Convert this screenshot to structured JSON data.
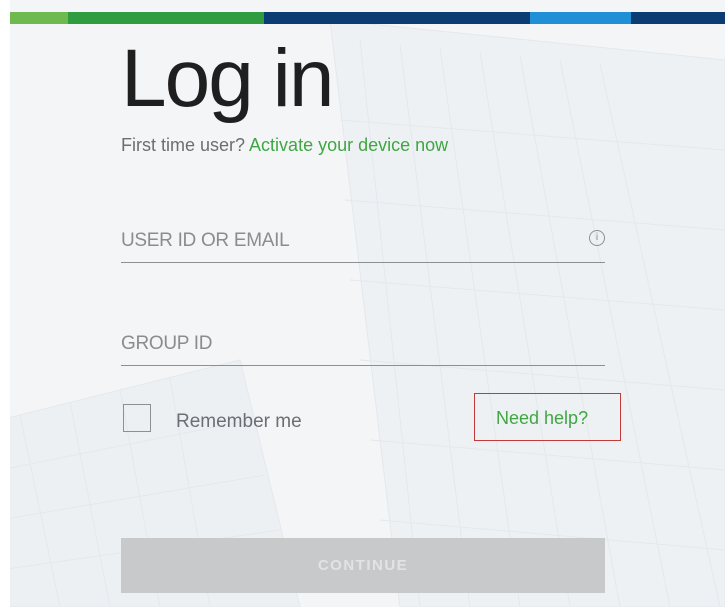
{
  "accent_bar": {
    "colors": [
      "#6fba4f",
      "#2f9c3f",
      "#0b3d72",
      "#1f8fd6",
      "#0b3d72"
    ]
  },
  "login": {
    "title": "Log in",
    "first_time_prefix": "First time user?",
    "activate_link": "Activate your device now",
    "user_id_placeholder": "USER ID OR EMAIL",
    "user_id_value": "",
    "group_id_placeholder": "GROUP ID",
    "group_id_value": "",
    "info_icon": "info-circle-icon",
    "remember_me_label": "Remember me",
    "remember_me_checked": false,
    "need_help_link": "Need help?",
    "continue_button": "CONTINUE"
  },
  "colors": {
    "link_green": "#3fa642",
    "highlight_border": "#c23a3a",
    "button_disabled": "#c7c9cb"
  }
}
